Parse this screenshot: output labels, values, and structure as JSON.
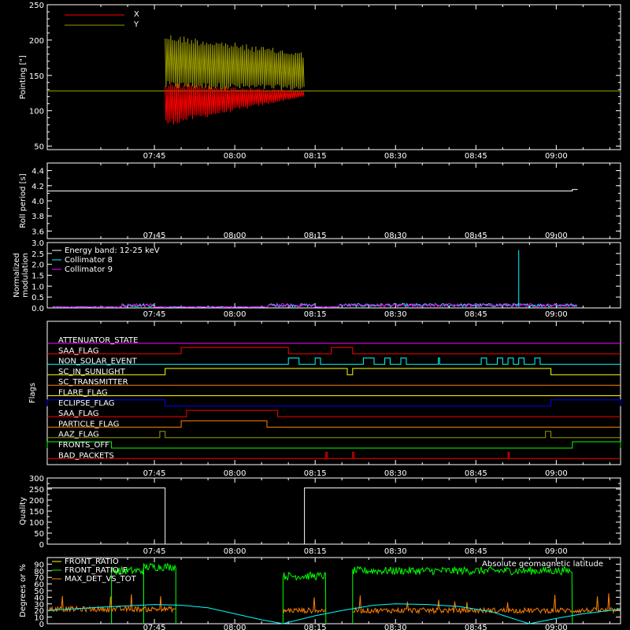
{
  "time_axis": {
    "start": "07:25",
    "end": "09:12",
    "ticks": [
      "07:45",
      "08:00",
      "08:15",
      "08:30",
      "08:45",
      "09:00"
    ]
  },
  "colors": {
    "background": "#000000",
    "axes": "#ffffff",
    "red": "#ff0000",
    "olive": "#9a9a00",
    "cyan": "#00ffff",
    "magenta": "#ff00ff",
    "green": "#00ff00",
    "orange": "#ff8000",
    "yellow": "#ffff00",
    "blue": "#0000ff"
  },
  "chart_data": [
    {
      "type": "line",
      "id": "pointing",
      "ylabel": "Pointing [\"]",
      "ylim": [
        45,
        250
      ],
      "yticks": [
        50,
        100,
        150,
        200,
        250
      ],
      "legend": [
        {
          "name": "X",
          "color": "#ff0000"
        },
        {
          "name": "Y",
          "color": "#9a9a00"
        }
      ],
      "series": [
        {
          "name": "X",
          "color": "#ff0000",
          "band": {
            "start": "07:47",
            "end": "08:13",
            "upper_start": 140,
            "upper_end": 128,
            "lower_start": 78,
            "lower_end": 120
          }
        },
        {
          "name": "Y",
          "color": "#9a9a00",
          "band": {
            "start": "07:47",
            "end": "08:13",
            "upper_start": 210,
            "upper_end": 183,
            "lower_start": 130,
            "lower_end": 128
          }
        },
        {
          "name": "reference",
          "color": "#9a9a00",
          "constant": 128
        }
      ]
    },
    {
      "type": "line",
      "id": "roll-period",
      "ylabel": "Roll period [s]",
      "ylim": [
        3.5,
        4.5
      ],
      "yticks": [
        3.6,
        3.8,
        4.0,
        4.2,
        4.4
      ],
      "series": [
        {
          "name": "roll period",
          "color": "#ffffff",
          "points": [
            [
              "07:25",
              4.13
            ],
            [
              "09:03",
              4.13
            ],
            [
              "09:03",
              4.15
            ],
            [
              "09:04",
              4.15
            ]
          ]
        }
      ]
    },
    {
      "type": "line",
      "id": "modulation",
      "ylabel": "Normalized modulation",
      "ylim": [
        0,
        3.0
      ],
      "yticks": [
        0.0,
        0.5,
        1.0,
        1.5,
        2.0,
        2.5,
        3.0
      ],
      "legend_text": [
        "Energy band: 12-25 keV",
        "Collimator 8",
        "Collimator 9"
      ],
      "legend_colors": [
        "#ffffff",
        "#00ffff",
        "#ff00ff"
      ],
      "segments": [
        [
          "07:26",
          "09:04"
        ]
      ],
      "spike": {
        "time": "08:53",
        "value": 2.65
      }
    },
    {
      "type": "step",
      "id": "flags",
      "ylabel": "Flags",
      "flags": [
        {
          "name": "ATTENUATOR_STATE",
          "color": "#ff00ff",
          "on": []
        },
        {
          "name": "SAA_FLAG",
          "color": "#ff0000",
          "on": [
            [
              "07:50",
              "08:10"
            ],
            [
              "08:18",
              "08:22"
            ]
          ]
        },
        {
          "name": "NON_SOLAR_EVENT",
          "color": "#00ffff",
          "on": [
            [
              "08:10",
              "08:12"
            ],
            [
              "08:15",
              "08:16"
            ],
            [
              "08:24",
              "08:26"
            ],
            [
              "08:28",
              "08:29"
            ],
            [
              "08:31",
              "08:32"
            ],
            [
              "08:38",
              "08:38"
            ],
            [
              "08:46",
              "08:47"
            ],
            [
              "08:49",
              "08:50"
            ],
            [
              "08:51",
              "08:52"
            ],
            [
              "08:53",
              "08:54"
            ],
            [
              "08:56",
              "08:57"
            ]
          ]
        },
        {
          "name": "SC_IN_SUNLIGHT",
          "color": "#ffff00",
          "on": [
            [
              "07:47",
              "08:21"
            ],
            [
              "08:22",
              "08:59"
            ]
          ]
        },
        {
          "name": "SC_TRANSMITTER",
          "color": "#ff8000",
          "on": []
        },
        {
          "name": "FLARE_FLAG",
          "color": "#ffff00",
          "on": []
        },
        {
          "name": "ECLIPSE_FLAG",
          "color": "#0000ff",
          "on": [
            [
              "07:25",
              "07:47"
            ],
            [
              "08:59",
              "09:12"
            ]
          ]
        },
        {
          "name": "SAA_FLAG",
          "color": "#ff0000",
          "on": [
            [
              "07:51",
              "08:08"
            ]
          ]
        },
        {
          "name": "PARTICLE_FLAG",
          "color": "#ff8000",
          "on": [
            [
              "07:50",
              "08:06"
            ]
          ]
        },
        {
          "name": "AAZ_FLAG",
          "color": "#9a9a00",
          "on": [
            [
              "07:46",
              "07:47"
            ],
            [
              "08:58",
              "08:59"
            ]
          ]
        },
        {
          "name": "FRONTS_OFF",
          "color": "#00ff00",
          "on": [
            [
              "07:25",
              "07:37"
            ],
            [
              "09:03",
              "09:12"
            ]
          ]
        },
        {
          "name": "BAD_PACKETS",
          "color": "#ff0000",
          "on": [
            [
              "08:17",
              "08:17"
            ],
            [
              "08:22",
              "08:22"
            ],
            [
              "08:51",
              "08:51"
            ]
          ]
        }
      ]
    },
    {
      "type": "line",
      "id": "quality",
      "ylabel": "Quality",
      "ylim": [
        0,
        300
      ],
      "yticks": [
        0,
        50,
        100,
        150,
        200,
        250,
        300
      ],
      "series": [
        {
          "name": "quality",
          "color": "#ffffff",
          "points": [
            [
              "07:25",
              255
            ],
            [
              "07:47",
              255
            ],
            [
              "07:47",
              0
            ],
            [
              "08:13",
              0
            ],
            [
              "08:13",
              255
            ],
            [
              "09:12",
              255
            ]
          ]
        }
      ]
    },
    {
      "type": "line",
      "id": "ratios",
      "ylabel": "Degrees or %",
      "ylim": [
        0,
        100
      ],
      "yticks": [
        0,
        10,
        20,
        30,
        40,
        50,
        60,
        70,
        80,
        90
      ],
      "legend_text": [
        "FRONT_RATIO",
        "FRONT_RATIO_F",
        "MAX_DET_VS_TOT"
      ],
      "legend_colors": [
        "#ffff00",
        "#00ff00",
        "#ff8000"
      ],
      "annotation": "Absolute geomagnetic latitude",
      "annotation_color": "#00ffff",
      "series": [
        {
          "name": "FRONT_RATIO_F",
          "color": "#00ff00",
          "segments": [
            [
              "07:37",
              "07:43",
              80
            ],
            [
              "07:43",
              "07:49",
              86
            ],
            [
              "08:09",
              "08:17",
              72
            ],
            [
              "08:22",
              "09:03",
              80
            ]
          ]
        },
        {
          "name": "MAX_DET_VS_TOT",
          "color": "#ff8000",
          "segments": [
            [
              "07:25",
              "07:49",
              22
            ],
            [
              "08:09",
              "08:17",
              20
            ],
            [
              "08:22",
              "09:12",
              20
            ]
          ]
        },
        {
          "name": "Absolute geomagnetic latitude",
          "color": "#00ffff",
          "points": [
            [
              "07:25",
              20
            ],
            [
              "07:35",
              25
            ],
            [
              "07:45",
              29
            ],
            [
              "07:50",
              28
            ],
            [
              "07:55",
              24
            ],
            [
              "08:00",
              15
            ],
            [
              "08:05",
              6
            ],
            [
              "08:09",
              0
            ],
            [
              "08:15",
              12
            ],
            [
              "08:20",
              20
            ],
            [
              "08:26",
              28
            ],
            [
              "08:30",
              30
            ],
            [
              "08:36",
              29
            ],
            [
              "08:42",
              26
            ],
            [
              "08:48",
              18
            ],
            [
              "08:53",
              5
            ],
            [
              "08:55",
              0
            ],
            [
              "09:00",
              8
            ],
            [
              "09:05",
              15
            ],
            [
              "09:12",
              22
            ]
          ]
        }
      ]
    }
  ]
}
